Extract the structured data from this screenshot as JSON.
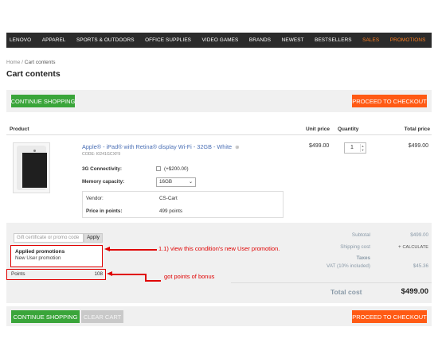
{
  "nav": {
    "items": [
      "LENOVO",
      "APPAREL",
      "SPORTS & OUTDOORS",
      "OFFICE SUPPLIES",
      "VIDEO GAMES",
      "BRANDS",
      "NEWEST",
      "BESTSELLERS",
      "SALES",
      "PROMOTIONS"
    ]
  },
  "breadcrumb": {
    "home": "Home",
    "sep": "/",
    "current": "Cart contents"
  },
  "page_title": "Cart contents",
  "buttons": {
    "continue_shopping": "CONTINUE SHOPPING",
    "proceed_checkout": "PROCEED TO CHECKOUT",
    "clear_cart": "CLEAR CART"
  },
  "table": {
    "headers": {
      "product": "Product",
      "unit_price": "Unit price",
      "quantity": "Quantity",
      "total_price": "Total price"
    }
  },
  "product": {
    "name": "Apple® - iPad® with Retina® display Wi-Fi - 32GB - White",
    "code": "CODE: I0241GCXF9",
    "options": {
      "connectivity_label": "3G Connectivity:",
      "connectivity_value": "(+$200.00)",
      "memory_label": "Memory capacity:",
      "memory_value": "16GB"
    },
    "vendor_label": "Vendor:",
    "vendor_value": "CS-Cart",
    "points_label": "Price in points:",
    "points_value": "499 points",
    "unit_price": "$499.00",
    "quantity": "1",
    "total_price": "$499.00"
  },
  "promo": {
    "placeholder": "Gift certificate or promo code",
    "apply": "Apply",
    "applied_title": "Applied promotions",
    "applied_name": "New User promotion",
    "points_label": "Points",
    "points_value": "108"
  },
  "annotations": {
    "promo_note": "1.1)  view this condition's new User promotion.",
    "points_note": "got points of bonus"
  },
  "summary": {
    "subtotal_label": "Subtotal",
    "subtotal_value": "$499.00",
    "shipping_label": "Shipping cost",
    "calculate": "CALCULATE",
    "taxes_label": "Taxes",
    "vat_label": "VAT (10% included)",
    "vat_value": "$45.36",
    "total_label": "Total cost",
    "total_value": "$499.00"
  },
  "colors": {
    "accent_green": "#3aa53a",
    "accent_orange": "#ff5a14",
    "annotation_red": "#e00000",
    "nav_bg": "#2b2b2b"
  }
}
